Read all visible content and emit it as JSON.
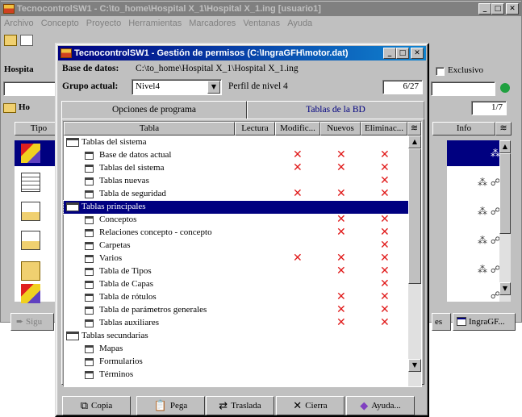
{
  "bg_window": {
    "title": "TecnocontrolSW1 - C:\\to_home\\Hospital X_1\\Hospital X_1.ing  [usuario1]",
    "menu": [
      "Archivo",
      "Concepto",
      "Proyecto",
      "Herramientas",
      "Marcadores",
      "Ventanas",
      "Ayuda"
    ],
    "label_hospital": "Hospita",
    "exclusive_label": "Exclusivo",
    "label_ho": "Ho",
    "col_tipo": "Tipo",
    "col_info": "Info",
    "page_counter": "1/7",
    "bottom_left_button": "Sigu",
    "bottom_right_button_1": "es",
    "bottom_right_button_2": "IngraGF..."
  },
  "dialog": {
    "title": "TecnocontrolSW1 - Gestión de permisos (C:\\IngraGFH\\motor.dat)",
    "db_label": "Base de datos:",
    "db_path": "C:\\to_home\\Hospital X_1\\Hospital X_1.ing",
    "group_label": "Grupo actual:",
    "group_value": "Nivel4",
    "profile_text": "Perfil de nivel 4",
    "counter": "6/27",
    "tabs": [
      {
        "label": "Opciones de programa",
        "active": true
      },
      {
        "label": "Tablas de la BD",
        "active": false
      }
    ],
    "columns": [
      "Tabla",
      "Lectura",
      "Modific...",
      "Nuevos",
      "Eliminac..."
    ],
    "rows": [
      {
        "label": "Tablas del sistema",
        "group": true,
        "lectura": false,
        "modific": false,
        "nuevos": false,
        "eliminac": false
      },
      {
        "label": "Base de datos actual",
        "group": false,
        "lectura": false,
        "modific": true,
        "nuevos": true,
        "eliminac": true
      },
      {
        "label": "Tablas del sistema",
        "group": false,
        "lectura": false,
        "modific": true,
        "nuevos": true,
        "eliminac": true
      },
      {
        "label": "Tablas nuevas",
        "group": false,
        "lectura": false,
        "modific": false,
        "nuevos": false,
        "eliminac": true
      },
      {
        "label": "Tabla de seguridad",
        "group": false,
        "lectura": false,
        "modific": true,
        "nuevos": true,
        "eliminac": true
      },
      {
        "label": "Tablas principales",
        "group": true,
        "selected": true,
        "lectura": false,
        "modific": false,
        "nuevos": false,
        "eliminac": false
      },
      {
        "label": "Conceptos",
        "group": false,
        "lectura": false,
        "modific": false,
        "nuevos": true,
        "eliminac": true
      },
      {
        "label": "Relaciones concepto - concepto",
        "group": false,
        "lectura": false,
        "modific": false,
        "nuevos": true,
        "eliminac": true
      },
      {
        "label": "Carpetas",
        "group": false,
        "lectura": false,
        "modific": false,
        "nuevos": false,
        "eliminac": true
      },
      {
        "label": "Varios",
        "group": false,
        "lectura": false,
        "modific": true,
        "nuevos": true,
        "eliminac": true
      },
      {
        "label": "Tabla de Tipos",
        "group": false,
        "lectura": false,
        "modific": false,
        "nuevos": true,
        "eliminac": true
      },
      {
        "label": "Tabla de Capas",
        "group": false,
        "lectura": false,
        "modific": false,
        "nuevos": false,
        "eliminac": true
      },
      {
        "label": "Tabla de rótulos",
        "group": false,
        "lectura": false,
        "modific": false,
        "nuevos": true,
        "eliminac": true
      },
      {
        "label": "Tabla de parámetros generales",
        "group": false,
        "lectura": false,
        "modific": false,
        "nuevos": true,
        "eliminac": true
      },
      {
        "label": "Tablas auxiliares",
        "group": false,
        "lectura": false,
        "modific": false,
        "nuevos": true,
        "eliminac": true
      },
      {
        "label": "Tablas secundarias",
        "group": true,
        "lectura": false,
        "modific": false,
        "nuevos": false,
        "eliminac": false
      },
      {
        "label": "Mapas",
        "group": false,
        "lectura": false,
        "modific": false,
        "nuevos": false,
        "eliminac": false
      },
      {
        "label": "Formularios",
        "group": false,
        "lectura": false,
        "modific": false,
        "nuevos": false,
        "eliminac": false
      },
      {
        "label": "Términos",
        "group": false,
        "lectura": false,
        "modific": false,
        "nuevos": false,
        "eliminac": false
      }
    ],
    "buttons": [
      {
        "label": "Copia",
        "icon": "copy-icon"
      },
      {
        "label": "Pega",
        "icon": "paste-icon"
      },
      {
        "label": "Traslada",
        "icon": "move-icon"
      },
      {
        "label": "Cierra",
        "icon": "close-x-icon"
      },
      {
        "label": "Ayuda...",
        "icon": "help-icon"
      }
    ],
    "mark_color": "#e01818",
    "selection_color": "#000080"
  }
}
